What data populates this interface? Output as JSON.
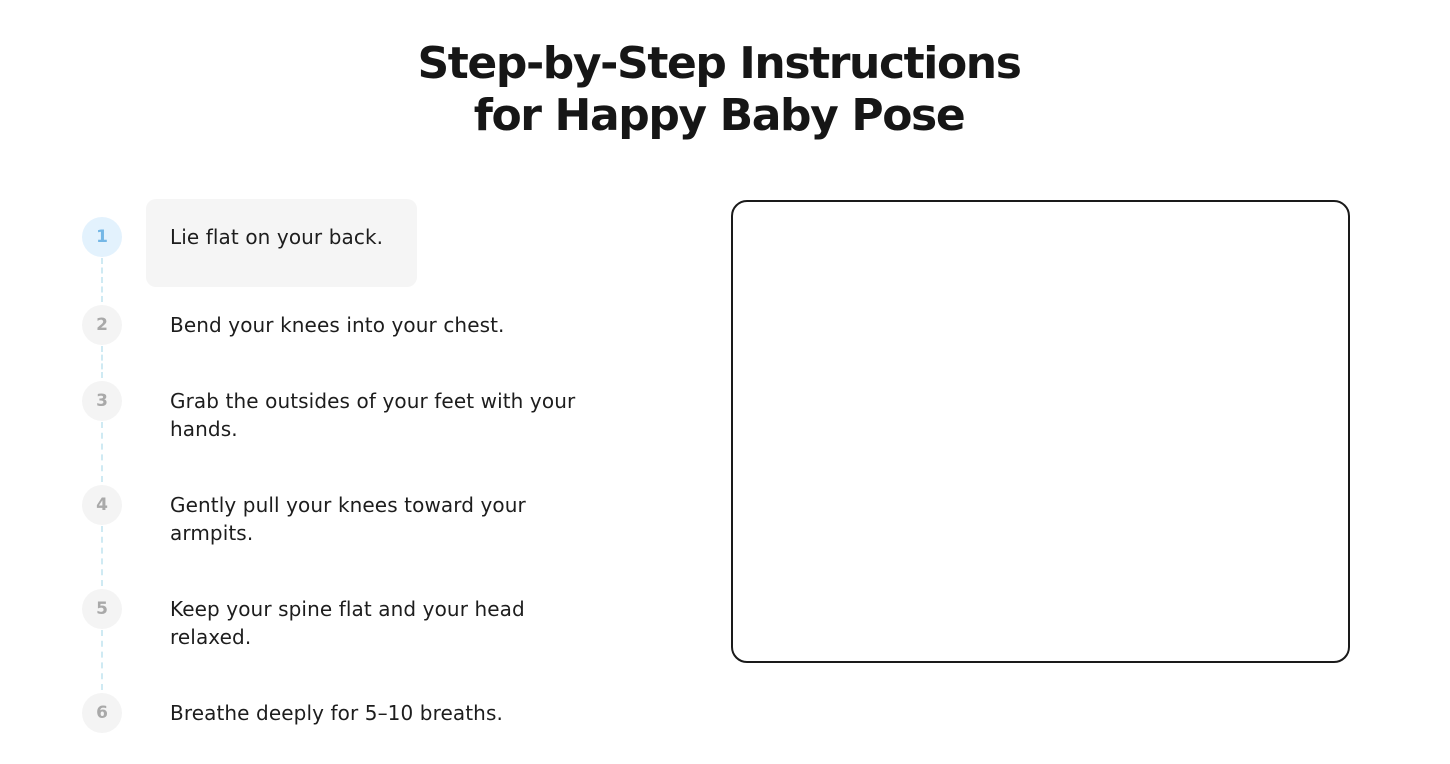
{
  "title": {
    "line1": "Step-by-Step Instructions",
    "line2": "for Happy Baby Pose"
  },
  "steps": [
    {
      "number": "1",
      "text": "Lie flat on your back.",
      "active": true
    },
    {
      "number": "2",
      "text": "Bend your knees into your chest.",
      "active": false
    },
    {
      "number": "3",
      "text": "Grab the outsides of your feet with your hands.",
      "active": false
    },
    {
      "number": "4",
      "text": "Gently pull your knees toward your armpits.",
      "active": false
    },
    {
      "number": "5",
      "text": "Keep your spine flat and your head relaxed.",
      "active": false
    },
    {
      "number": "6",
      "text": "Breathe deeply for 5–10 breaths.",
      "active": false
    }
  ],
  "colors": {
    "active_badge_bg": "#e3f2fd",
    "active_badge_text": "#74b7e6",
    "inactive_badge_bg": "#f4f4f4",
    "inactive_badge_text": "#a9a9a9",
    "connector": "#cfeaf3",
    "active_card_bg": "#f5f5f5",
    "frame_border": "#1a1a1a"
  }
}
